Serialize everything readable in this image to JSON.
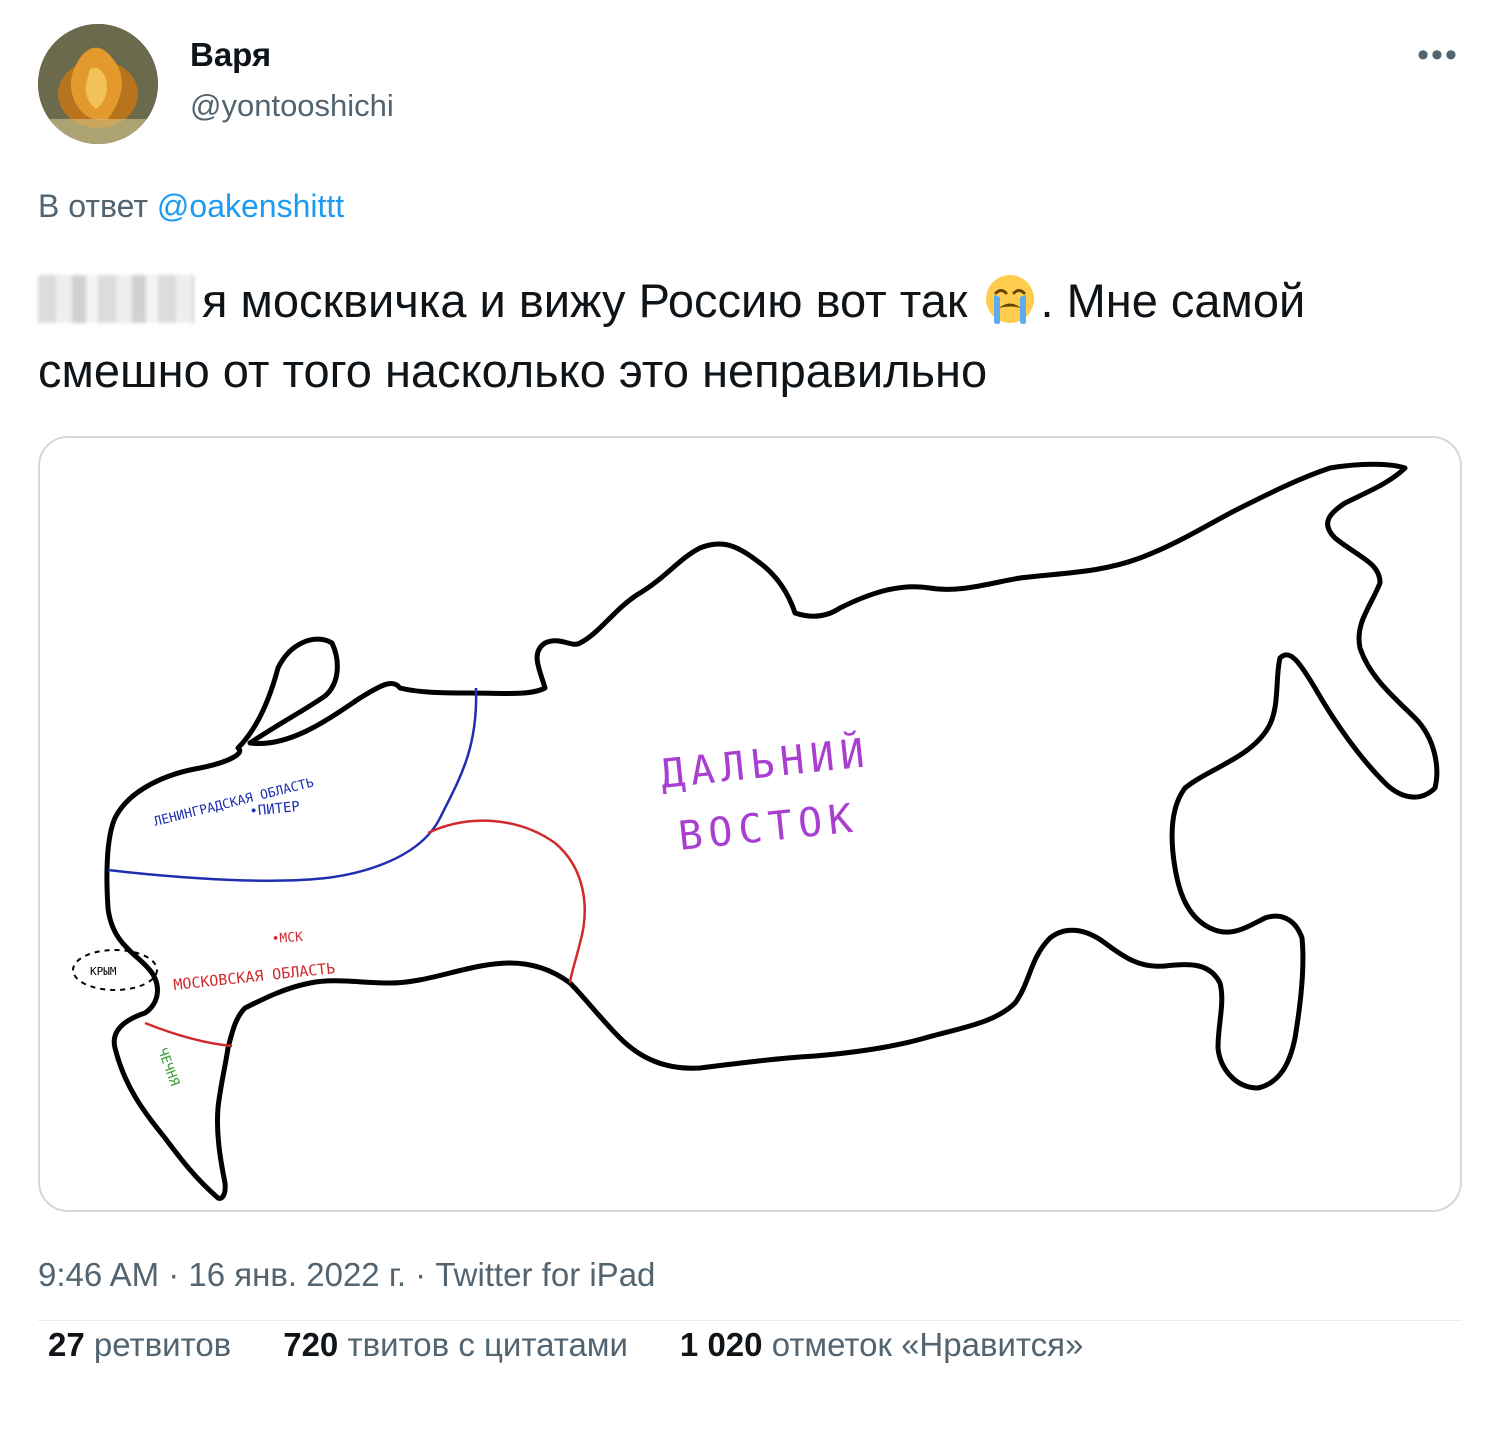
{
  "user": {
    "display_name": "Варя",
    "handle": "@yontooshichi"
  },
  "more_label": "•••",
  "reply": {
    "prefix": "В ответ",
    "mention": "@oakenshittt"
  },
  "tweet": {
    "text_part1": "я москвичка и вижу Россию вот так",
    "emoji": "loudly-crying-face",
    "text_part2": ". Мне самой смешно от того насколько это неправильно"
  },
  "map": {
    "labels": {
      "leningrad_region": "ЛЕНИНГРАДСКАЯ ОБЛАСТЬ",
      "piter": "•ПИТЕР",
      "msk": "•МСК",
      "moscow_region": "МОСКОВСКАЯ ОБЛАСТЬ",
      "crimea": "КРЫМ",
      "chechnya": "ЧЕЧНЯ",
      "far_east_line1": "ДАЛЬНИЙ",
      "far_east_line2": "ВОСТОК"
    },
    "colors": {
      "outline": "#000000",
      "leningrad": "#1f2fb0",
      "moscow": "#d12a2a",
      "chechnya": "#3a9a3a",
      "far_east": "#a83fd0"
    }
  },
  "meta": {
    "time": "9:46 AM",
    "date": "16 янв. 2022 г.",
    "app": "Twitter for iPad",
    "separator": " · "
  },
  "stats": {
    "retweets_count": "27",
    "retweets_label": "ретвитов",
    "quotes_count": "720",
    "quotes_label": "твитов с цитатами",
    "likes_count": "1 020",
    "likes_label": "отметок «Нравится»"
  }
}
